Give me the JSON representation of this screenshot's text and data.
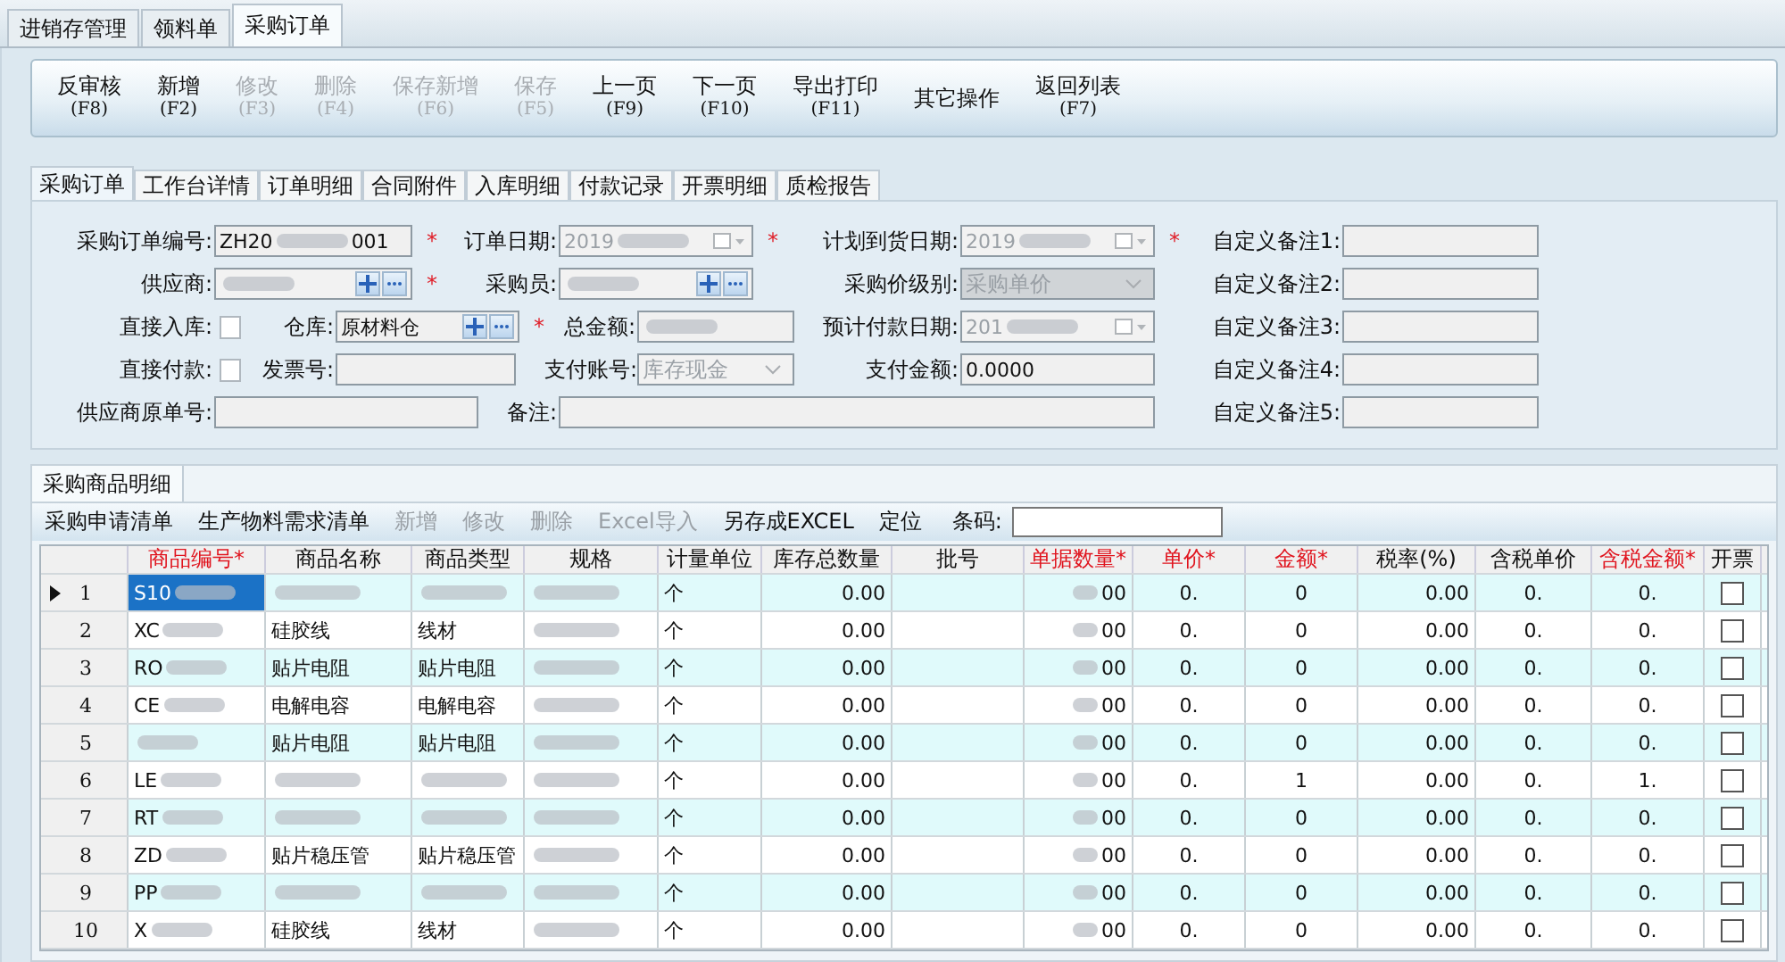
{
  "app_tabs": [
    {
      "label": "进销存管理",
      "selected": false
    },
    {
      "label": "领料单",
      "selected": false
    },
    {
      "label": "采购订单",
      "selected": true
    }
  ],
  "toolbar": [
    {
      "label": "反审核",
      "key": "(F8)",
      "disabled": false
    },
    {
      "label": "新增",
      "key": "(F2)",
      "disabled": false
    },
    {
      "label": "修改",
      "key": "(F3)",
      "disabled": true
    },
    {
      "label": "删除",
      "key": "(F4)",
      "disabled": true
    },
    {
      "label": "保存新增",
      "key": "(F6)",
      "disabled": true
    },
    {
      "label": "保存",
      "key": "(F5)",
      "disabled": true
    },
    {
      "label": "上一页",
      "key": "(F9)",
      "disabled": false
    },
    {
      "label": "下一页",
      "key": "(F10)",
      "disabled": false
    },
    {
      "label": "导出打印",
      "key": "(F11)",
      "disabled": false
    },
    {
      "label": "其它操作",
      "disabled": false
    },
    {
      "label": "返回列表",
      "key": "(F7)",
      "disabled": false
    }
  ],
  "detail_tabs": [
    {
      "label": "采购订单",
      "selected": true
    },
    {
      "label": "工作台详情",
      "selected": false
    },
    {
      "label": "订单明细",
      "selected": false
    },
    {
      "label": "合同附件",
      "selected": false
    },
    {
      "label": "入库明细",
      "selected": false
    },
    {
      "label": "付款记录",
      "selected": false
    },
    {
      "label": "开票明细",
      "selected": false
    },
    {
      "label": "质检报告",
      "selected": false
    }
  ],
  "form": {
    "fields": [
      {
        "label": "采购订单编号:",
        "kind": "text",
        "value": "ZH20",
        "value_end": "001",
        "blurred": true,
        "required_mark": "*"
      },
      {
        "label": "订单日期:",
        "kind": "date",
        "value": "2019",
        "blurred": true,
        "disabled": true,
        "required_mark": "*"
      },
      {
        "label": "计划到货日期:",
        "kind": "date",
        "value": "2019",
        "blurred": true,
        "disabled": true,
        "required_mark": "*"
      },
      {
        "label": "自定义备注1:",
        "kind": "text"
      },
      {
        "label": "供应商:",
        "kind": "lookup",
        "blurred": true,
        "disabled": true,
        "required_mark": "*"
      },
      {
        "label": "采购员:",
        "kind": "lookup",
        "blurred": true,
        "disabled": true
      },
      {
        "label": "采购价级别:",
        "kind": "select",
        "value": "采购单价",
        "disabled": true
      },
      {
        "label": "自定义备注2:",
        "kind": "text"
      },
      {
        "label": "直接入库:",
        "kind": "checkbox",
        "checked": false
      },
      {
        "label": "仓库:",
        "kind": "lookup",
        "value": "原材料仓",
        "required_mark": "*"
      },
      {
        "label": "总金额:",
        "kind": "text",
        "blurred": true
      },
      {
        "label": "预计付款日期:",
        "kind": "date",
        "value": "201",
        "blurred": true,
        "disabled": true
      },
      {
        "label": "自定义备注3:",
        "kind": "text"
      },
      {
        "label": "直接付款:",
        "kind": "checkbox",
        "checked": false
      },
      {
        "label": "发票号:",
        "kind": "text"
      },
      {
        "label": "支付账号:",
        "kind": "select",
        "value": "库存现金",
        "disabled": true
      },
      {
        "label": "支付金额:",
        "kind": "text",
        "value": "0.0000"
      },
      {
        "label": "自定义备注4:",
        "kind": "text"
      },
      {
        "label": "供应商原单号:",
        "kind": "text"
      },
      {
        "label": "备注:",
        "kind": "text"
      },
      {
        "label": "自定义备注5:",
        "kind": "text"
      }
    ]
  },
  "section_tab": {
    "label": "采购商品明细",
    "selected": true
  },
  "grid_toolbar": [
    {
      "label": "采购申请清单",
      "disabled": false
    },
    {
      "label": "生产物料需求清单",
      "disabled": false
    },
    {
      "label": "新增",
      "disabled": true
    },
    {
      "label": "修改",
      "disabled": true
    },
    {
      "label": "删除",
      "disabled": true
    },
    {
      "label": "Excel导入",
      "disabled": true
    },
    {
      "label": "另存成EXCEL",
      "disabled": false
    },
    {
      "label": "定位",
      "disabled": false
    }
  ],
  "barcode": {
    "label": "条码:"
  },
  "table": {
    "columns": [
      {
        "label": "商品编号*",
        "required": true
      },
      {
        "label": "商品名称",
        "required": false
      },
      {
        "label": "商品类型",
        "required": false
      },
      {
        "label": "规格",
        "required": false
      },
      {
        "label": "计量单位",
        "required": false
      },
      {
        "label": "库存总数量",
        "required": false
      },
      {
        "label": "批号",
        "required": false
      },
      {
        "label": "单据数量*",
        "required": true
      },
      {
        "label": "单价*",
        "required": true
      },
      {
        "label": "金额*",
        "required": true
      },
      {
        "label": "税率(%)",
        "required": false
      },
      {
        "label": "含税单价",
        "required": false
      },
      {
        "label": "含税金额*",
        "required": true
      },
      {
        "label": "开票",
        "required": false
      }
    ],
    "rows": [
      {
        "no": "1",
        "selected": true,
        "code": "S10",
        "unit": "个",
        "stock": "0.00",
        "qty": "00",
        "price": "0.",
        "amount": "0",
        "rate": "0.00",
        "tax_price": "0.",
        "tax_amount": "0.",
        "invoiced": false
      },
      {
        "no": "2",
        "selected": false,
        "code": "XC",
        "name": "硅胶线",
        "type": "线材",
        "unit": "个",
        "stock": "0.00",
        "qty": "00",
        "price": "0.",
        "amount": "0",
        "rate": "0.00",
        "tax_price": "0.",
        "tax_amount": "0.",
        "invoiced": false
      },
      {
        "no": "3",
        "selected": false,
        "code": "RO",
        "name": "贴片电阻",
        "type": "贴片电阻",
        "unit": "个",
        "stock": "0.00",
        "qty": "00",
        "price": "0.",
        "amount": "0",
        "rate": "0.00",
        "tax_price": "0.",
        "tax_amount": "0.",
        "invoiced": false
      },
      {
        "no": "4",
        "selected": false,
        "code": "CE",
        "name": "电解电容",
        "type": "电解电容",
        "unit": "个",
        "stock": "0.00",
        "qty": "00",
        "price": "0.",
        "amount": "0",
        "rate": "0.00",
        "tax_price": "0.",
        "tax_amount": "0.",
        "invoiced": false
      },
      {
        "no": "5",
        "selected": false,
        "name": "贴片电阻",
        "type": "贴片电阻",
        "unit": "个",
        "stock": "0.00",
        "qty": "00",
        "price": "0.",
        "amount": "0",
        "rate": "0.00",
        "tax_price": "0.",
        "tax_amount": "0.",
        "invoiced": false
      },
      {
        "no": "6",
        "selected": false,
        "code": "LE",
        "unit": "个",
        "stock": "0.00",
        "qty": "00",
        "price": "0.",
        "amount": "1",
        "rate": "0.00",
        "tax_price": "0.",
        "tax_amount": "1.",
        "invoiced": false
      },
      {
        "no": "7",
        "selected": false,
        "code": "RT",
        "unit": "个",
        "stock": "0.00",
        "qty": "00",
        "price": "0.",
        "amount": "0",
        "rate": "0.00",
        "tax_price": "0.",
        "tax_amount": "0.",
        "invoiced": false
      },
      {
        "no": "8",
        "selected": false,
        "code": "ZD",
        "name": "贴片稳压管",
        "type": "贴片稳压管",
        "unit": "个",
        "stock": "0.00",
        "qty": "00",
        "price": "0.",
        "amount": "0",
        "rate": "0.00",
        "tax_price": "0.",
        "tax_amount": "0.",
        "invoiced": false
      },
      {
        "no": "9",
        "selected": false,
        "code": "PP",
        "unit": "个",
        "stock": "0.00",
        "qty": "00",
        "price": "0.",
        "amount": "0",
        "rate": "0.00",
        "tax_price": "0.",
        "tax_amount": "0.",
        "invoiced": false
      },
      {
        "no": "10",
        "selected": false,
        "code": "X",
        "name": "硅胶线",
        "type": "线材",
        "unit": "个",
        "stock": "0.00",
        "qty": "00",
        "price": "0.",
        "amount": "0",
        "rate": "0.00",
        "tax_price": "0.",
        "tax_amount": "0.",
        "invoiced": false
      }
    ]
  }
}
